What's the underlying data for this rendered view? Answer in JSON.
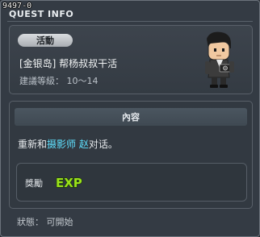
{
  "window": {
    "quest_id": "9497-0",
    "title": "QUEST INFO"
  },
  "quest": {
    "category": "活動",
    "name": "[金银岛] 帮杨叔叔干活",
    "level_label": "建議等級",
    "level_sep": "：",
    "level_range": "10～14",
    "avatar_icon": "npc-avatar-icon"
  },
  "content": {
    "header": "內容",
    "text_prefix": "重新和",
    "npc_name": "摄影师 赵",
    "text_suffix": "对话。"
  },
  "reward": {
    "label": "獎勵",
    "exp_icon": "exp-icon",
    "exp_text": "EXP"
  },
  "status": {
    "label": "狀態",
    "sep": "：",
    "value": "可開始"
  },
  "colors": {
    "background": "#343b44",
    "npc_highlight": "#5fe1ff",
    "exp_green": "#9be21a"
  }
}
